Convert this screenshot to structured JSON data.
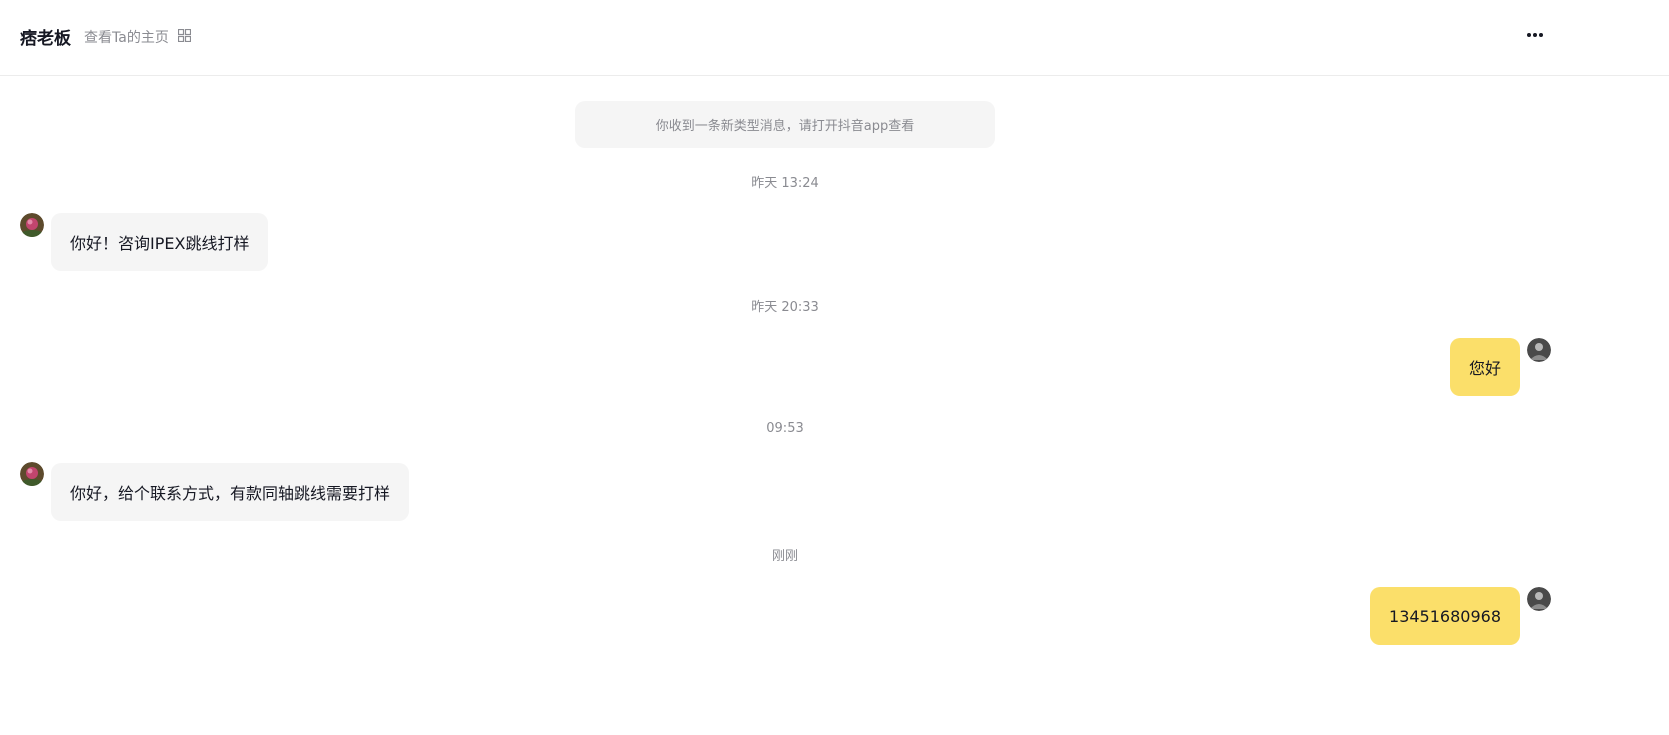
{
  "header": {
    "title": "痞老板",
    "profile_link": "查看Ta的主页",
    "qr_icon": "qr-code-icon",
    "more_icon": "more-options-icon"
  },
  "notice": "你收到一条新类型消息，请打开抖音app查看",
  "timestamps": [
    "昨天 13:24",
    "昨天 20:33",
    "09:53",
    "刚刚"
  ],
  "messages": [
    {
      "from": "contact",
      "text": "你好！咨询IPEX跳线打样"
    },
    {
      "from": "me",
      "text": "您好"
    },
    {
      "from": "contact",
      "text": "你好，给个联系方式，有款同轴跳线需要打样"
    },
    {
      "from": "me",
      "text": "13451680968"
    }
  ],
  "colors": {
    "outgoing_bubble": "#fbdf6a",
    "incoming_bubble": "#f5f5f5",
    "notice_bg": "#f5f5f5",
    "muted_text": "#8a8b91"
  }
}
